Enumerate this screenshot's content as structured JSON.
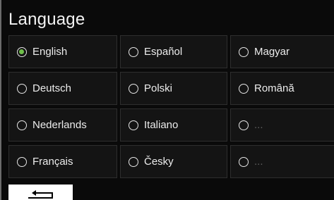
{
  "screen": {
    "title": "Language"
  },
  "languages": [
    {
      "label": "English",
      "selected": true
    },
    {
      "label": "Español",
      "selected": false
    },
    {
      "label": "Magyar",
      "selected": false
    },
    {
      "label": "Deutsch",
      "selected": false
    },
    {
      "label": "Polski",
      "selected": false
    },
    {
      "label": "Română",
      "selected": false
    },
    {
      "label": "Nederlands",
      "selected": false
    },
    {
      "label": "Italiano",
      "selected": false
    },
    {
      "label": "...",
      "selected": false
    },
    {
      "label": "Français",
      "selected": false
    },
    {
      "label": "Česky",
      "selected": false
    },
    {
      "label": "...",
      "selected": false
    }
  ],
  "footer": {
    "back_icon": "return-arrow-icon"
  },
  "colors": {
    "accent": "#6fbf4a",
    "background": "#0a0a0a",
    "tile": "#141414"
  }
}
